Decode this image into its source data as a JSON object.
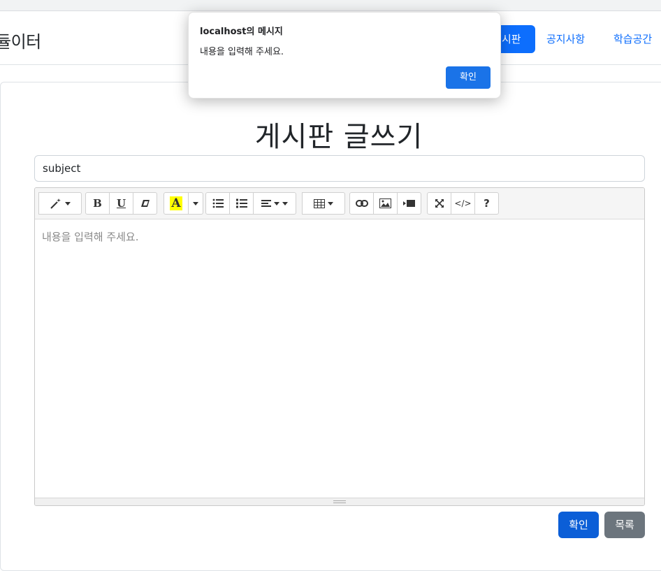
{
  "nav": {
    "brand": "듈이터",
    "items": [
      {
        "label": "시판"
      },
      {
        "label": "공지사항"
      },
      {
        "label": "학습공간"
      }
    ]
  },
  "form": {
    "title": "게시판 글쓰기",
    "subject_value": "subject",
    "editor_placeholder": "내용을 입력해 주세요.",
    "confirm_label": "확인",
    "list_label": "목록"
  },
  "toolbar": {
    "bold": "B",
    "underline": "U",
    "color": "A",
    "help": "?",
    "code": "</>"
  },
  "dialog": {
    "title": "localhost의 메시지",
    "message": "내용을 입력해 주세요.",
    "ok_label": "확인",
    "accent": "#1a73e8"
  },
  "colors": {
    "primary": "#0d6efd",
    "secondary": "#6c757d",
    "highlight": "#ffff00"
  }
}
